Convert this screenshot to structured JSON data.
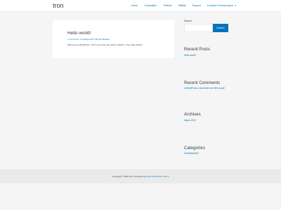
{
  "header": {
    "site_title": "tron",
    "nav": [
      {
        "label": "Home"
      },
      {
        "label": "Competition"
      },
      {
        "label": "Timeline"
      },
      {
        "label": "Affiliate"
      },
      {
        "label": "Support"
      },
      {
        "label": "Founders' Entrepreneurs"
      }
    ]
  },
  "post": {
    "title": "Hello world!",
    "meta_comments": "1 Comment",
    "meta_sep1": " / ",
    "meta_category": "Uncategorized",
    "meta_sep2": " / By ",
    "meta_author": "Illia Marakin",
    "body": "Welcome to WordPress. This is your first post. Edit or delete it, then start writing!"
  },
  "sidebar": {
    "search_label": "Search",
    "search_placeholder": "",
    "search_button": "Search",
    "recent_posts_title": "Recent Posts",
    "recent_posts_item": "Hello world!",
    "recent_comments_title": "Recent Comments",
    "recent_comment_author": "A WordPress Commenter",
    "recent_comment_on": " on ",
    "recent_comment_post": "Hello world!",
    "archives_title": "Archives",
    "archives_item": "March 2022",
    "categories_title": "Categories",
    "categories_item": "Uncategorized"
  },
  "footer": {
    "copyright": "Copyright © 2022 tron | Powered by ",
    "theme_link": "Astra WordPress Theme"
  },
  "colors": {
    "accent": "#0274be",
    "background": "#f5f5f5",
    "text": "#3a3a3a"
  }
}
